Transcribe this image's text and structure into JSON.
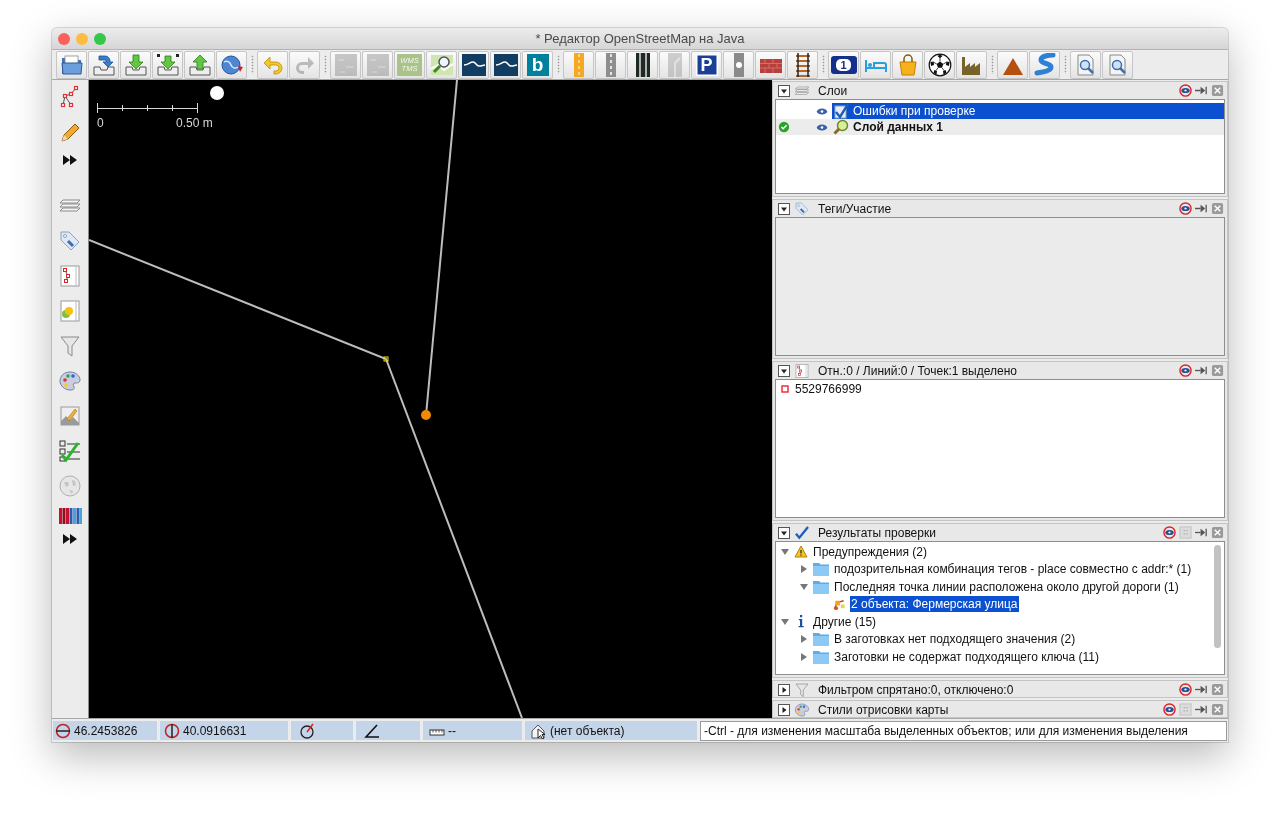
{
  "window": {
    "title": "* Редактор OpenStreetMap на Java"
  },
  "toolbar": [
    [
      {
        "kind": "open",
        "disabled": false
      },
      {
        "kind": "open-location",
        "disabled": false
      },
      {
        "kind": "download",
        "disabled": false
      },
      {
        "kind": "download-area",
        "disabled": false
      },
      {
        "kind": "upload",
        "disabled": false
      },
      {
        "kind": "update",
        "disabled": false
      }
    ],
    [
      {
        "kind": "undo",
        "disabled": false
      },
      {
        "kind": "redo",
        "disabled": true
      }
    ],
    [
      {
        "kind": "tile",
        "disabled": true
      },
      {
        "kind": "tile",
        "disabled": true
      },
      {
        "kind": "wms",
        "lines": [
          "WMS",
          "TMS"
        ],
        "disabled": false
      },
      {
        "kind": "map-search",
        "disabled": false
      },
      {
        "kind": "imagery",
        "disabled": false
      },
      {
        "kind": "imagery",
        "disabled": false
      },
      {
        "kind": "bing",
        "label": "b",
        "disabled": false
      }
    ],
    [
      {
        "kind": "road-primary",
        "disabled": false
      },
      {
        "kind": "road-residential",
        "disabled": false
      },
      {
        "kind": "road-track",
        "disabled": false
      },
      {
        "kind": "junction",
        "disabled": true
      },
      {
        "kind": "parking",
        "label": "P",
        "disabled": false
      },
      {
        "kind": "signals",
        "disabled": false
      },
      {
        "kind": "wall",
        "disabled": false
      },
      {
        "kind": "railway",
        "disabled": false
      }
    ],
    [
      {
        "kind": "address",
        "label": "1",
        "disabled": false
      },
      {
        "kind": "hotel",
        "disabled": false
      },
      {
        "kind": "shop",
        "disabled": false
      },
      {
        "kind": "sport",
        "disabled": false
      },
      {
        "kind": "industrial",
        "disabled": false
      }
    ],
    [
      {
        "kind": "peak",
        "disabled": false
      },
      {
        "kind": "river",
        "disabled": false
      }
    ],
    [
      {
        "kind": "find",
        "disabled": false
      },
      {
        "kind": "find",
        "disabled": false
      }
    ]
  ],
  "sidebar": [
    [
      {
        "kind": "select"
      },
      {
        "kind": "draw"
      },
      {
        "kind": "more"
      }
    ],
    [
      {
        "kind": "layers"
      },
      {
        "kind": "tags"
      },
      {
        "kind": "selection"
      },
      {
        "kind": "relations"
      },
      {
        "kind": "filters"
      },
      {
        "kind": "styles"
      },
      {
        "kind": "style-edit"
      },
      {
        "kind": "validator"
      },
      {
        "kind": "globe"
      },
      {
        "kind": "colors"
      },
      {
        "kind": "more"
      }
    ]
  ],
  "map": {
    "scale_labels": [
      "0",
      "0.50 m"
    ]
  },
  "panels": [
    {
      "kind": "layers",
      "title": "Слои",
      "expanded": true,
      "settings_button": false,
      "layers": [
        {
          "kind": "validator",
          "name": "Ошибки при проверке",
          "visible": true,
          "active": false,
          "selected": true
        },
        {
          "kind": "data",
          "name": "Слой данных 1",
          "visible": true,
          "active": true,
          "selected": false
        }
      ]
    },
    {
      "kind": "tags",
      "title": "Теги/Участие",
      "expanded": true,
      "settings_button": false
    },
    {
      "kind": "selection",
      "title": "Отн.:0 / Линий:0 / Точек:1 выделено",
      "expanded": true,
      "settings_button": false,
      "items": [
        {
          "kind": "node",
          "label": "5529766999"
        }
      ]
    },
    {
      "kind": "validation",
      "title": "Результаты проверки",
      "expanded": true,
      "settings_button": true,
      "tree": [
        {
          "kind": "warning",
          "label": "Предупреждения (2)",
          "expanded": true,
          "selected": false,
          "children": [
            {
              "kind": "folder",
              "label": "подозрительная комбинация тегов - place совместно с addr:* (1)",
              "expanded": false,
              "selected": false
            },
            {
              "kind": "folder",
              "label": "Последняя точка линии расположена около другой дороги (1)",
              "expanded": true,
              "selected": false,
              "children": [
                {
                  "kind": "object",
                  "label": "2 объекта: Фермерская улица",
                  "selected": true
                }
              ]
            }
          ]
        },
        {
          "kind": "info",
          "label": "Другие (15)",
          "expanded": true,
          "selected": false,
          "children": [
            {
              "kind": "folder",
              "label": "В заготовках нет подходящего значения (2)",
              "expanded": false,
              "selected": false
            },
            {
              "kind": "folder",
              "label": "Заготовки не содержат подходящего ключа (11)",
              "expanded": false,
              "selected": false
            }
          ]
        }
      ]
    },
    {
      "kind": "filter",
      "title": "Фильтром спрятано:0, отключено:0",
      "expanded": false,
      "settings_button": false
    },
    {
      "kind": "styles",
      "title": "Стили отрисовки карты",
      "expanded": false,
      "settings_button": true
    }
  ],
  "status_bar": {
    "fields": [
      {
        "kind": "lat",
        "value": "46.2453826"
      },
      {
        "kind": "lon",
        "value": "40.0916631"
      },
      {
        "kind": "heading"
      },
      {
        "kind": "angle"
      },
      {
        "kind": "distance",
        "value": "--"
      },
      {
        "kind": "name",
        "value": "(нет объекта)"
      }
    ],
    "message": "-Ctrl - для изменения масштаба выделенных объектов; или для изменения выделения"
  }
}
